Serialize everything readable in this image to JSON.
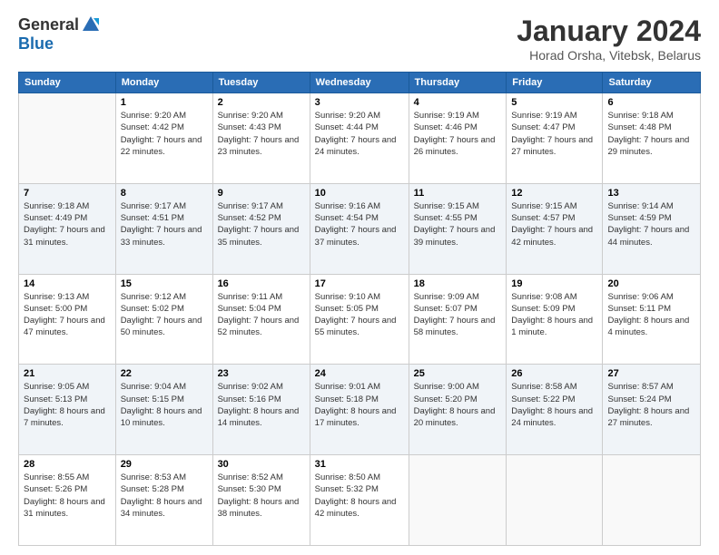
{
  "logo": {
    "general": "General",
    "blue": "Blue"
  },
  "title": "January 2024",
  "subtitle": "Horad Orsha, Vitebsk, Belarus",
  "days_header": [
    "Sunday",
    "Monday",
    "Tuesday",
    "Wednesday",
    "Thursday",
    "Friday",
    "Saturday"
  ],
  "weeks": [
    [
      {
        "day": "",
        "sunrise": "",
        "sunset": "",
        "daylight": ""
      },
      {
        "day": "1",
        "sunrise": "Sunrise: 9:20 AM",
        "sunset": "Sunset: 4:42 PM",
        "daylight": "Daylight: 7 hours and 22 minutes."
      },
      {
        "day": "2",
        "sunrise": "Sunrise: 9:20 AM",
        "sunset": "Sunset: 4:43 PM",
        "daylight": "Daylight: 7 hours and 23 minutes."
      },
      {
        "day": "3",
        "sunrise": "Sunrise: 9:20 AM",
        "sunset": "Sunset: 4:44 PM",
        "daylight": "Daylight: 7 hours and 24 minutes."
      },
      {
        "day": "4",
        "sunrise": "Sunrise: 9:19 AM",
        "sunset": "Sunset: 4:46 PM",
        "daylight": "Daylight: 7 hours and 26 minutes."
      },
      {
        "day": "5",
        "sunrise": "Sunrise: 9:19 AM",
        "sunset": "Sunset: 4:47 PM",
        "daylight": "Daylight: 7 hours and 27 minutes."
      },
      {
        "day": "6",
        "sunrise": "Sunrise: 9:18 AM",
        "sunset": "Sunset: 4:48 PM",
        "daylight": "Daylight: 7 hours and 29 minutes."
      }
    ],
    [
      {
        "day": "7",
        "sunrise": "Sunrise: 9:18 AM",
        "sunset": "Sunset: 4:49 PM",
        "daylight": "Daylight: 7 hours and 31 minutes."
      },
      {
        "day": "8",
        "sunrise": "Sunrise: 9:17 AM",
        "sunset": "Sunset: 4:51 PM",
        "daylight": "Daylight: 7 hours and 33 minutes."
      },
      {
        "day": "9",
        "sunrise": "Sunrise: 9:17 AM",
        "sunset": "Sunset: 4:52 PM",
        "daylight": "Daylight: 7 hours and 35 minutes."
      },
      {
        "day": "10",
        "sunrise": "Sunrise: 9:16 AM",
        "sunset": "Sunset: 4:54 PM",
        "daylight": "Daylight: 7 hours and 37 minutes."
      },
      {
        "day": "11",
        "sunrise": "Sunrise: 9:15 AM",
        "sunset": "Sunset: 4:55 PM",
        "daylight": "Daylight: 7 hours and 39 minutes."
      },
      {
        "day": "12",
        "sunrise": "Sunrise: 9:15 AM",
        "sunset": "Sunset: 4:57 PM",
        "daylight": "Daylight: 7 hours and 42 minutes."
      },
      {
        "day": "13",
        "sunrise": "Sunrise: 9:14 AM",
        "sunset": "Sunset: 4:59 PM",
        "daylight": "Daylight: 7 hours and 44 minutes."
      }
    ],
    [
      {
        "day": "14",
        "sunrise": "Sunrise: 9:13 AM",
        "sunset": "Sunset: 5:00 PM",
        "daylight": "Daylight: 7 hours and 47 minutes."
      },
      {
        "day": "15",
        "sunrise": "Sunrise: 9:12 AM",
        "sunset": "Sunset: 5:02 PM",
        "daylight": "Daylight: 7 hours and 50 minutes."
      },
      {
        "day": "16",
        "sunrise": "Sunrise: 9:11 AM",
        "sunset": "Sunset: 5:04 PM",
        "daylight": "Daylight: 7 hours and 52 minutes."
      },
      {
        "day": "17",
        "sunrise": "Sunrise: 9:10 AM",
        "sunset": "Sunset: 5:05 PM",
        "daylight": "Daylight: 7 hours and 55 minutes."
      },
      {
        "day": "18",
        "sunrise": "Sunrise: 9:09 AM",
        "sunset": "Sunset: 5:07 PM",
        "daylight": "Daylight: 7 hours and 58 minutes."
      },
      {
        "day": "19",
        "sunrise": "Sunrise: 9:08 AM",
        "sunset": "Sunset: 5:09 PM",
        "daylight": "Daylight: 8 hours and 1 minute."
      },
      {
        "day": "20",
        "sunrise": "Sunrise: 9:06 AM",
        "sunset": "Sunset: 5:11 PM",
        "daylight": "Daylight: 8 hours and 4 minutes."
      }
    ],
    [
      {
        "day": "21",
        "sunrise": "Sunrise: 9:05 AM",
        "sunset": "Sunset: 5:13 PM",
        "daylight": "Daylight: 8 hours and 7 minutes."
      },
      {
        "day": "22",
        "sunrise": "Sunrise: 9:04 AM",
        "sunset": "Sunset: 5:15 PM",
        "daylight": "Daylight: 8 hours and 10 minutes."
      },
      {
        "day": "23",
        "sunrise": "Sunrise: 9:02 AM",
        "sunset": "Sunset: 5:16 PM",
        "daylight": "Daylight: 8 hours and 14 minutes."
      },
      {
        "day": "24",
        "sunrise": "Sunrise: 9:01 AM",
        "sunset": "Sunset: 5:18 PM",
        "daylight": "Daylight: 8 hours and 17 minutes."
      },
      {
        "day": "25",
        "sunrise": "Sunrise: 9:00 AM",
        "sunset": "Sunset: 5:20 PM",
        "daylight": "Daylight: 8 hours and 20 minutes."
      },
      {
        "day": "26",
        "sunrise": "Sunrise: 8:58 AM",
        "sunset": "Sunset: 5:22 PM",
        "daylight": "Daylight: 8 hours and 24 minutes."
      },
      {
        "day": "27",
        "sunrise": "Sunrise: 8:57 AM",
        "sunset": "Sunset: 5:24 PM",
        "daylight": "Daylight: 8 hours and 27 minutes."
      }
    ],
    [
      {
        "day": "28",
        "sunrise": "Sunrise: 8:55 AM",
        "sunset": "Sunset: 5:26 PM",
        "daylight": "Daylight: 8 hours and 31 minutes."
      },
      {
        "day": "29",
        "sunrise": "Sunrise: 8:53 AM",
        "sunset": "Sunset: 5:28 PM",
        "daylight": "Daylight: 8 hours and 34 minutes."
      },
      {
        "day": "30",
        "sunrise": "Sunrise: 8:52 AM",
        "sunset": "Sunset: 5:30 PM",
        "daylight": "Daylight: 8 hours and 38 minutes."
      },
      {
        "day": "31",
        "sunrise": "Sunrise: 8:50 AM",
        "sunset": "Sunset: 5:32 PM",
        "daylight": "Daylight: 8 hours and 42 minutes."
      },
      {
        "day": "",
        "sunrise": "",
        "sunset": "",
        "daylight": ""
      },
      {
        "day": "",
        "sunrise": "",
        "sunset": "",
        "daylight": ""
      },
      {
        "day": "",
        "sunrise": "",
        "sunset": "",
        "daylight": ""
      }
    ]
  ]
}
